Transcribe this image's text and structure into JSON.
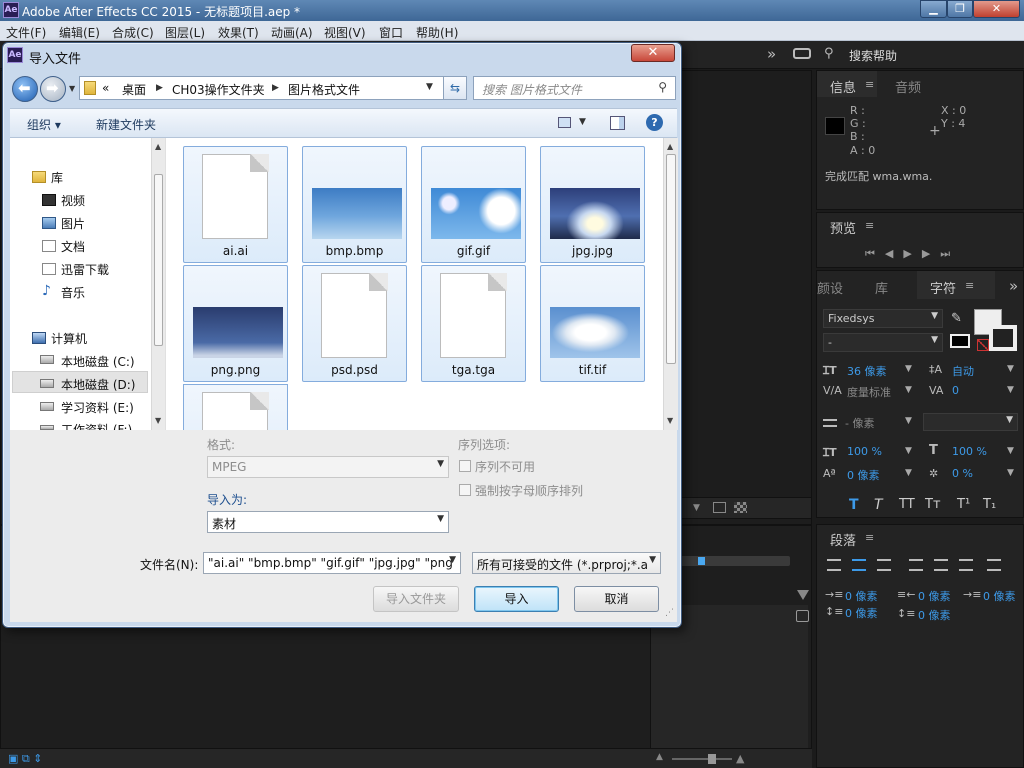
{
  "window": {
    "icon": "Ae",
    "title": "Adobe After Effects CC 2015 - 无标题项目.aep *",
    "minimize": "▁",
    "maximize": "❐",
    "close": "✕"
  },
  "menu": [
    "文件(F)",
    "编辑(E)",
    "合成(C)",
    "图层(L)",
    "效果(T)",
    "动画(A)",
    "视图(V)",
    "窗口",
    "帮助(H)"
  ],
  "ae": {
    "overflow": "»",
    "search_help": "搜索帮助",
    "info_tab": "信息",
    "audio_tab": "音频",
    "panel_menu": "≡",
    "info_r": "R :",
    "info_g": "G :",
    "info_b": "B :",
    "info_a": "A : 0",
    "info_x": "X : 0",
    "info_y": "Y : 4",
    "info_status": "完成匹配 wma.wma.",
    "preview_tab": "预览",
    "tabs3": [
      "颜设",
      "库",
      "字符"
    ],
    "font": "Fixedsys",
    "font_style": "-",
    "font_size": "36 像素",
    "leading": "自动",
    "kerning": "度量标准",
    "tracking": "0",
    "stroke": "- 像素",
    "vscale": "100 %",
    "hscale": "100 %",
    "baseline": "0 像素",
    "tsume": "0 %",
    "type_styles": [
      "T",
      "T",
      "TT",
      "Tт",
      "T¹",
      "T₁"
    ],
    "paragraph_tab": "段落",
    "indent1": "0 像素",
    "indent2": "0 像素",
    "indent3": "0 像素",
    "indent4": "0 像素",
    "indent5": "0 像素"
  },
  "dialog": {
    "title": "导入文件",
    "close": "✕",
    "breadcrumb": [
      "«",
      "桌面",
      "CH03操作文件夹",
      "图片格式文件"
    ],
    "search_placeholder": "搜索 图片格式文件",
    "organize": "组织 ▾",
    "new_folder": "新建文件夹",
    "nav": {
      "libraries": "库",
      "videos": "视频",
      "pictures": "图片",
      "documents": "文档",
      "thunder": "迅雷下载",
      "music": "音乐",
      "computer": "计算机",
      "drive_c": "本地磁盘 (C:)",
      "drive_d": "本地磁盘 (D:)",
      "drive_e": "学习资料 (E:)",
      "drive_f": "工作资料 (F:)"
    },
    "files": [
      "ai.ai",
      "bmp.bmp",
      "gif.gif",
      "jpg.jpg",
      "png.png",
      "psd.psd",
      "tga.tga",
      "tif.tif"
    ],
    "format_label": "格式:",
    "format_value": "MPEG",
    "sequence_label": "序列选项:",
    "seq_unavailable": "序列不可用",
    "force_alpha": "强制按字母顺序排列",
    "import_as_label": "导入为:",
    "import_as_value": "素材",
    "filename_label": "文件名(N):",
    "filename_value": "\"ai.ai\" \"bmp.bmp\" \"gif.gif\" \"jpg.jpg\" \"png",
    "filetype_value": "所有可接受的文件 (*.prproj;*.a",
    "import_folder": "导入文件夹",
    "import": "导入",
    "cancel": "取消"
  },
  "colors": {
    "accent_blue": "#3d9ae8",
    "selection": "#dcebfa"
  }
}
